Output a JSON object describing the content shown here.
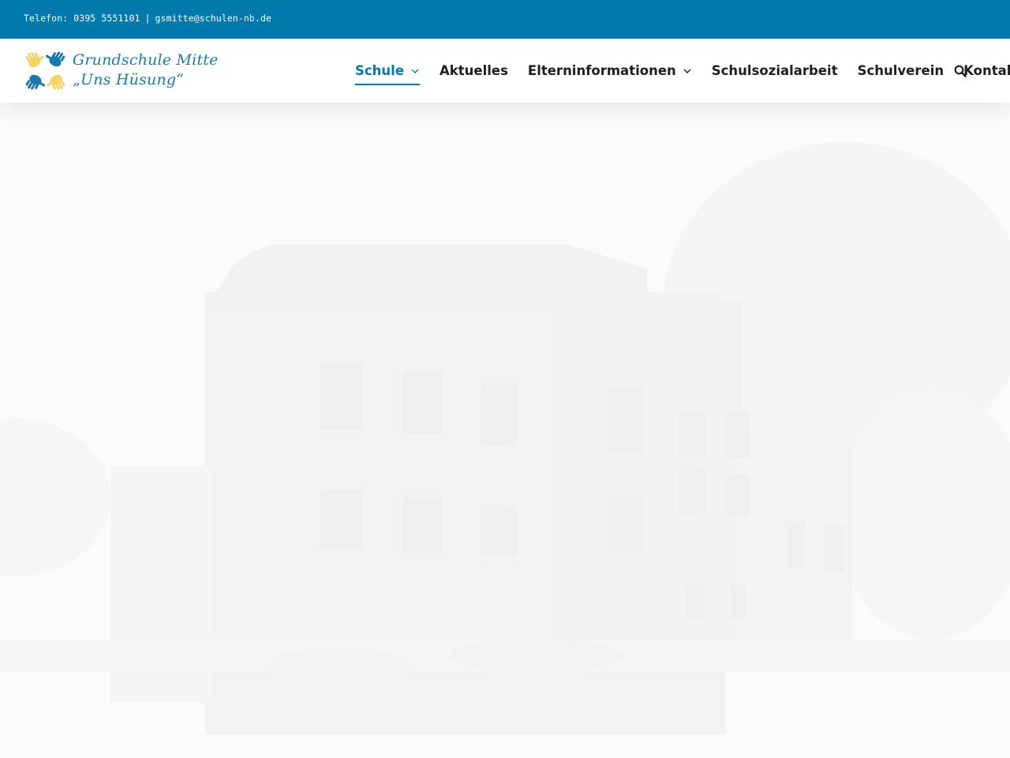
{
  "topbar": {
    "phone_text": "Telefon: 0395 5551101",
    "separator": "|",
    "email": "gsmitte@schulen-nb.de",
    "background_color": "#0079ad"
  },
  "brand": {
    "name_line1": "Grundschule Mitte",
    "name_line2": "„Uns Hüsung“",
    "logo_icon": "hands-icon",
    "colors": {
      "yellow": "#f3d36a",
      "blue": "#1a7ba8"
    }
  },
  "nav": {
    "items": [
      {
        "label": "Schule",
        "has_dropdown": true,
        "active": true
      },
      {
        "label": "Aktuelles",
        "has_dropdown": false,
        "active": false
      },
      {
        "label": "Elterninformationen",
        "has_dropdown": true,
        "active": false
      },
      {
        "label": "Schulsozialarbeit",
        "has_dropdown": false,
        "active": false
      },
      {
        "label": "Schulverein",
        "has_dropdown": false,
        "active": false
      },
      {
        "label": "Kontakt",
        "has_dropdown": false,
        "active": false
      }
    ],
    "search_icon": "search-icon",
    "accent_color": "#0079ad"
  },
  "hero": {
    "image_subject": "faded school building background"
  }
}
